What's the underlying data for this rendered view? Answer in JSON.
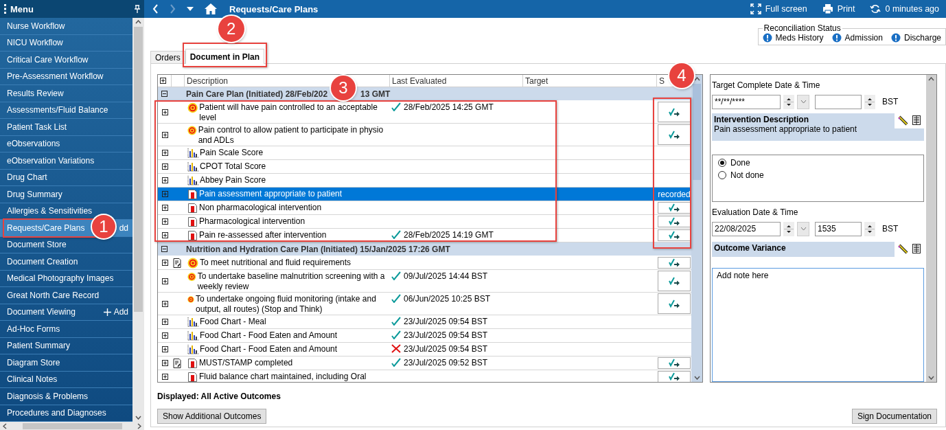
{
  "sidebar": {
    "title": "Menu",
    "items": [
      {
        "label": "Nurse Workflow",
        "selected": false
      },
      {
        "label": "NICU Workflow",
        "selected": false
      },
      {
        "label": "Critical Care Workflow",
        "selected": false
      },
      {
        "label": "Pre-Assessment Workflow",
        "selected": false
      },
      {
        "label": "Results Review",
        "selected": false
      },
      {
        "label": "Assessments/Fluid Balance",
        "selected": false
      },
      {
        "label": "Patient Task List",
        "selected": false
      },
      {
        "label": "eObservations",
        "selected": false
      },
      {
        "label": "eObservation Variations",
        "selected": false
      },
      {
        "label": "Drug Chart",
        "selected": false
      },
      {
        "label": "Drug Summary",
        "selected": false
      },
      {
        "label": "Allergies & Sensitivities",
        "selected": false
      },
      {
        "label": "Requests/Care Plans",
        "selected": true,
        "action": "dd",
        "action_icon": false
      },
      {
        "label": "Document Store",
        "selected": false
      },
      {
        "label": "Document Creation",
        "selected": false
      },
      {
        "label": "Medical Photography Images",
        "selected": false
      },
      {
        "label": "Great North Care Record",
        "selected": false
      },
      {
        "label": "Document Viewing",
        "selected": false,
        "action": "Add",
        "action_icon": true
      },
      {
        "label": "Ad-Hoc Forms",
        "selected": false
      },
      {
        "label": "Patient Summary",
        "selected": false
      },
      {
        "label": "Diagram Store",
        "selected": false
      },
      {
        "label": "Clinical Notes",
        "selected": false
      },
      {
        "label": "Diagnosis & Problems",
        "selected": false
      },
      {
        "label": "Procedures and Diagnoses",
        "selected": false
      }
    ]
  },
  "toolbar": {
    "title": "Requests/Care Plans",
    "actions": [
      {
        "kind": "fullscreen",
        "label": "Full screen"
      },
      {
        "kind": "print",
        "label": "Print"
      },
      {
        "kind": "refresh",
        "label": "0 minutes ago"
      }
    ]
  },
  "reconciliation": {
    "title": "Reconciliation Status",
    "items": [
      "Meds History",
      "Admission",
      "Discharge"
    ]
  },
  "tabs": [
    {
      "label": "Orders",
      "selected": false
    },
    {
      "label": "Document in Plan",
      "selected": true
    }
  ],
  "table": {
    "columns": [
      "Description",
      "Last Evaluated",
      "Target",
      "S"
    ],
    "rows": [
      {
        "kind": "group",
        "title": "Pain Care Plan (Initiated) 28/Feb/202",
        "title_tail": "13 GMT",
        "expanded": true,
        "selected": false
      },
      {
        "kind": "goal",
        "description": "Patient will have pain controlled to an acceptable level",
        "note": false,
        "met": true,
        "last_evaluated": "28/Feb/2025 14:25 GMT",
        "document_button": true,
        "selected": false
      },
      {
        "kind": "goal",
        "description": "Pain control to allow patient to participate in physio and ADLs",
        "note": false,
        "document_button": true,
        "selected": false
      },
      {
        "kind": "chart",
        "description": "Pain Scale Score",
        "note": false,
        "document_button": false,
        "selected": false
      },
      {
        "kind": "chart",
        "description": "CPOT Total Score",
        "note": false,
        "document_button": false,
        "selected": false
      },
      {
        "kind": "chart",
        "description": "Abbey Pain Score",
        "note": false,
        "document_button": false,
        "selected": false
      },
      {
        "kind": "intervention",
        "description": "Pain assessment appropriate to patient",
        "note": false,
        "document_button": false,
        "status": "recorded",
        "selected": true
      },
      {
        "kind": "intervention",
        "description": "Non pharmacological intervention",
        "note": false,
        "document_button": true,
        "selected": false
      },
      {
        "kind": "intervention",
        "description": "Pharmacological intervention",
        "note": false,
        "document_button": true,
        "selected": false
      },
      {
        "kind": "intervention",
        "description": "Pain re-assessed after intervention",
        "note": false,
        "met": true,
        "last_evaluated": "28/Feb/2025 14:19 GMT",
        "document_button": true,
        "selected": false
      },
      {
        "kind": "group",
        "title": "Nutrition and Hydration Care Plan (Initiated) 15/Jan/2025 17:26 GMT",
        "expanded": true,
        "selected": false
      },
      {
        "kind": "goal",
        "description": "To meet nutritional and fluid requirements",
        "note": true,
        "document_button": true,
        "selected": false
      },
      {
        "kind": "goal",
        "description": "To undertake baseline malnutrition screening with a weekly review",
        "note": false,
        "met": true,
        "last_evaluated": "09/Jul/2025 14:44 BST",
        "document_button": true,
        "selected": false
      },
      {
        "kind": "goal",
        "description": "To undertake ongoing fluid monitoring (intake and output, all routes) (Stop and Think)",
        "note": false,
        "met": true,
        "last_evaluated": "06/Jun/2025 10:25 BST",
        "document_button": true,
        "selected": false
      },
      {
        "kind": "chart",
        "description": "Food Chart - Meal",
        "note": false,
        "met": true,
        "last_evaluated": "23/Jul/2025 09:54 BST",
        "document_button": false,
        "selected": false
      },
      {
        "kind": "chart",
        "description": "Food Chart - Food Eaten and Amount",
        "note": false,
        "met": true,
        "last_evaluated": "23/Jul/2025 09:54 BST",
        "document_button": false,
        "selected": false
      },
      {
        "kind": "chart",
        "description": "Food Chart - Food Eaten and Amount",
        "note": false,
        "met": false,
        "last_evaluated": "23/Jul/2025 09:54 BST",
        "document_button": false,
        "selected": false
      },
      {
        "kind": "intervention",
        "description": "MUST/STAMP completed",
        "note": true,
        "met": true,
        "last_evaluated": "23/Jul/2025 09:52 BST",
        "document_button": true,
        "selected": false
      },
      {
        "kind": "intervention",
        "description": "Fluid balance chart maintained, including Oral",
        "note": false,
        "document_button": true,
        "selected": false
      }
    ]
  },
  "footer": {
    "displayed": "Displayed: All Active Outcomes",
    "show_button": "Show Additional Outcomes",
    "sign_button": "Sign Documentation"
  },
  "detail": {
    "target_label": "Target Complete Date & Time",
    "target_date": "**/**/****",
    "target_zone": "BST",
    "intervention_title": "Intervention Description",
    "intervention_text": "Pain assessment appropriate to patient",
    "options": [
      {
        "label": "Done",
        "selected": true
      },
      {
        "label": "Not done",
        "selected": false
      }
    ],
    "evaluation_label": "Evaluation Date & Time",
    "evaluation_date": "22/08/2025",
    "evaluation_time": "1535",
    "evaluation_zone": "BST",
    "variance_title": "Outcome Variance",
    "note": "Add note here"
  },
  "annotations": [
    {
      "label": "1"
    },
    {
      "label": "2"
    },
    {
      "label": "3"
    },
    {
      "label": "4"
    }
  ]
}
